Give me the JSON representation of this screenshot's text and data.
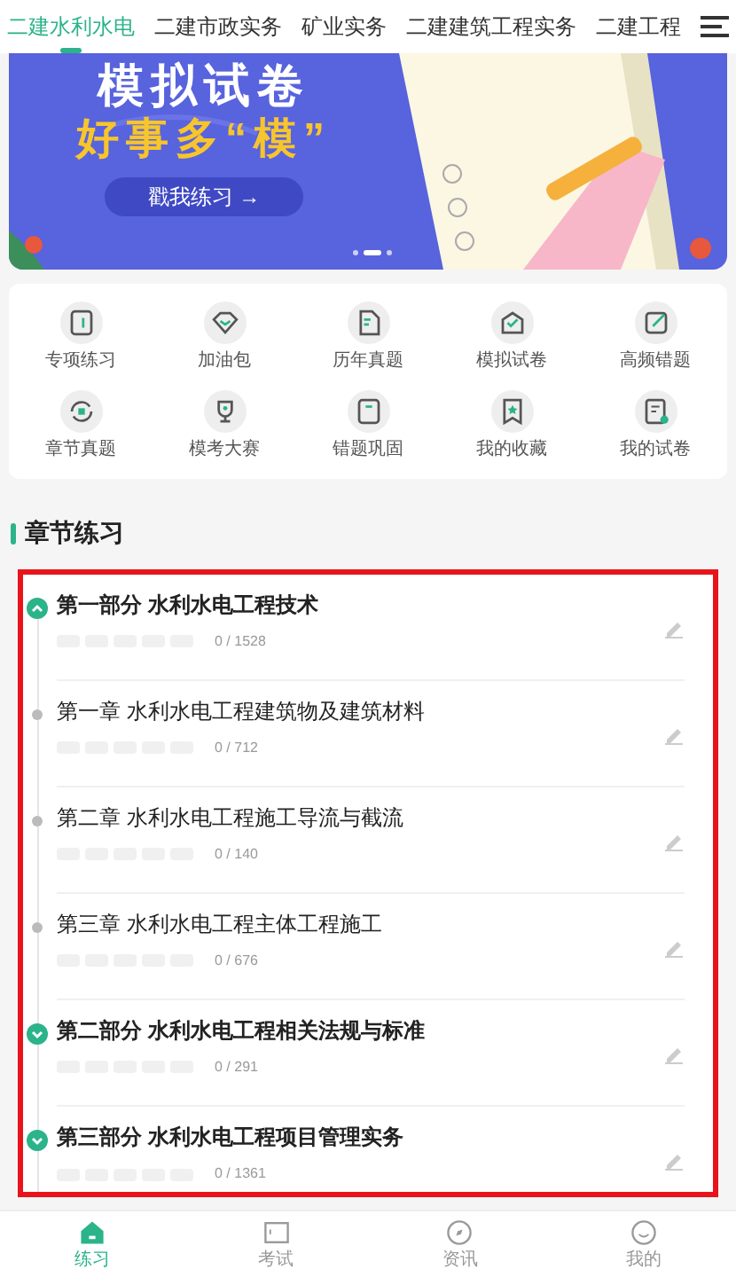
{
  "tabs": [
    {
      "label": "二建水利水电",
      "selected": true
    },
    {
      "label": "二建市政实务",
      "selected": false
    },
    {
      "label": "矿业实务",
      "selected": false
    },
    {
      "label": "二建建筑工程实务",
      "selected": false
    },
    {
      "label": "二建工程",
      "selected": false
    }
  ],
  "banner": {
    "title": "模拟试卷",
    "slogan": "好事多“模”",
    "button": "戳我练习 →"
  },
  "shortcuts": [
    {
      "label": "专项练习"
    },
    {
      "label": "加油包"
    },
    {
      "label": "历年真题"
    },
    {
      "label": "模拟试卷"
    },
    {
      "label": "高频错题"
    },
    {
      "label": "章节真题"
    },
    {
      "label": "模考大赛"
    },
    {
      "label": "错题巩固"
    },
    {
      "label": "我的收藏"
    },
    {
      "label": "我的试卷"
    }
  ],
  "section_title": "章节练习",
  "chapters": [
    {
      "title": "第一部分 水利水电工程技术",
      "count": "0 / 1528",
      "expanded": true,
      "children": [
        {
          "title": "第一章 水利水电工程建筑物及建筑材料",
          "count": "0 / 712"
        },
        {
          "title": "第二章 水利水电工程施工导流与截流",
          "count": "0 / 140"
        },
        {
          "title": "第三章 水利水电工程主体工程施工",
          "count": "0 / 676"
        }
      ]
    },
    {
      "title": "第二部分 水利水电工程相关法规与标准",
      "count": "0 / 291",
      "expanded": false
    },
    {
      "title": "第三部分 水利水电工程项目管理实务",
      "count": "0 / 1361",
      "expanded": false
    }
  ],
  "bottom_nav": [
    {
      "label": "练习",
      "selected": true
    },
    {
      "label": "考试",
      "selected": false
    },
    {
      "label": "资讯",
      "selected": false
    },
    {
      "label": "我的",
      "selected": false
    }
  ]
}
